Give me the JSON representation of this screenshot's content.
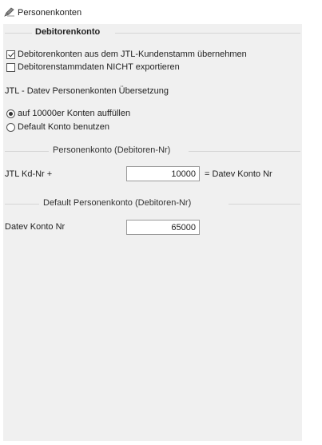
{
  "window": {
    "title": "Personenkonten"
  },
  "debitorenkonto": {
    "header": "Debitorenkonto",
    "options": [
      {
        "label": "Debitorenkonten aus dem JTL-Kundenstamm übernehmen",
        "checked": true
      },
      {
        "label": "Debitorenstammdaten NICHT exportieren",
        "checked": false
      }
    ]
  },
  "uebersetzung": {
    "header": "JTL - Datev Personenkonten Übersetzung",
    "options": [
      {
        "label": "auf 10000er Konten auffüllen",
        "selected": true
      },
      {
        "label": "Default Konto benutzen",
        "selected": false
      }
    ]
  },
  "personenkonto": {
    "header": "Personenkonto (Debitoren-Nr)",
    "field_label": "JTL Kd-Nr +",
    "value": "10000",
    "suffix": "= Datev Konto Nr"
  },
  "default_personenkonto": {
    "header": "Default Personenkonto (Debitoren-Nr)",
    "field_label": "Datev Konto Nr",
    "value": "65000"
  },
  "colors": {
    "panel_background": "#f0f0f0",
    "window_background": "#ffffff",
    "divider": "#d5d5d5",
    "field_border": "#9a9a9a"
  }
}
